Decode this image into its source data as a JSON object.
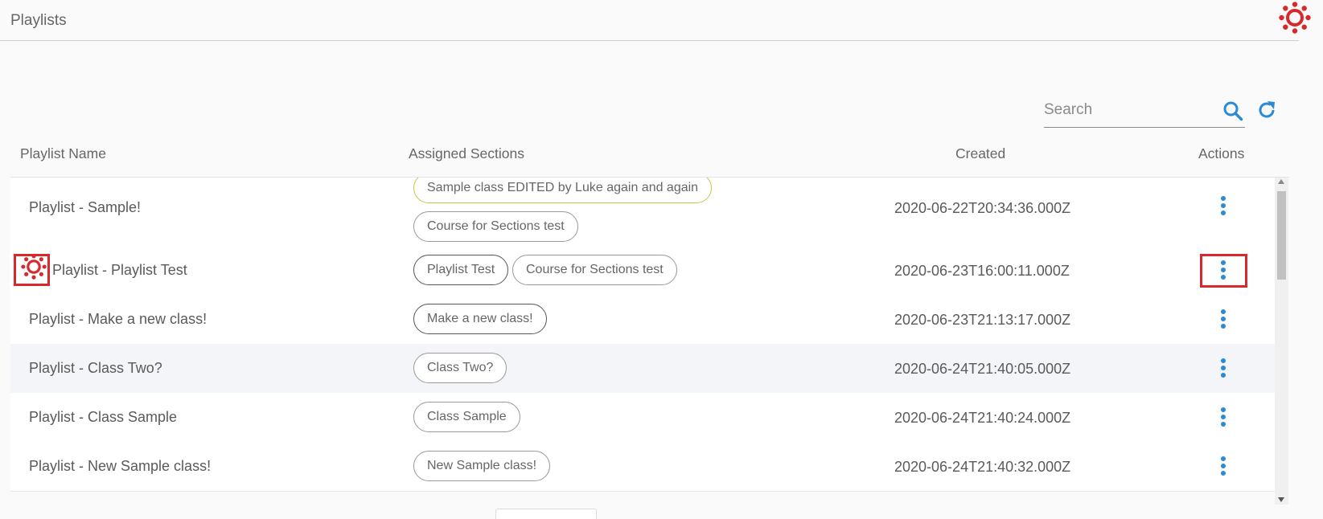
{
  "header": {
    "title": "Playlists"
  },
  "search": {
    "placeholder": "Search",
    "value": ""
  },
  "icons": {
    "search": "search-icon",
    "refresh": "refresh-icon",
    "actions": "kebab-menu-icon",
    "logo": "canvas-logo-icon"
  },
  "colors": {
    "accent": "#2a8ad4",
    "logo": "#d9282c",
    "highlight": "#d9282c",
    "chip_highlight": "#c4c74a"
  },
  "table": {
    "columns": {
      "name": "Playlist Name",
      "sections": "Assigned Sections",
      "created": "Created",
      "actions": "Actions"
    },
    "rows": [
      {
        "name": "Playlist - Sample!",
        "sections": [
          "Sample class EDITED by Luke again and again",
          "Course for Sections test"
        ],
        "created": "2020-06-22T20:34:36.000Z"
      },
      {
        "name": "Playlist - Playlist Test",
        "sections": [
          "Playlist Test",
          "Course for Sections test"
        ],
        "created": "2020-06-23T16:00:11.000Z"
      },
      {
        "name": "Playlist - Make a new class!",
        "sections": [
          "Make a new class!"
        ],
        "created": "2020-06-23T21:13:17.000Z"
      },
      {
        "name": "Playlist - Class Two?",
        "sections": [
          "Class Two?"
        ],
        "created": "2020-06-24T21:40:05.000Z"
      },
      {
        "name": "Playlist - Class Sample",
        "sections": [
          "Class Sample"
        ],
        "created": "2020-06-24T21:40:24.000Z"
      },
      {
        "name": "Playlist - New Sample class!",
        "sections": [
          "New Sample class!"
        ],
        "created": "2020-06-24T21:40:32.000Z"
      }
    ]
  }
}
